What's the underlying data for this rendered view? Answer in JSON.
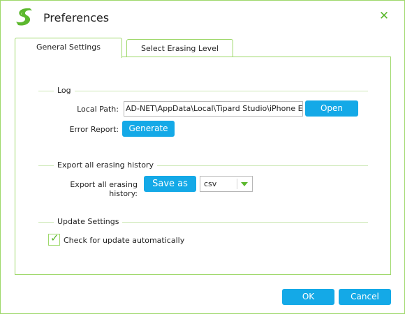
{
  "window": {
    "title": "Preferences",
    "close_glyph": "✕"
  },
  "tabs": [
    {
      "label": "General Settings",
      "active": true
    },
    {
      "label": "Select Erasing Level",
      "active": false
    }
  ],
  "log": {
    "section_title": "Log",
    "local_path_label": "Local Path:",
    "local_path_value": "AD-NET\\AppData\\Local\\Tipard Studio\\iPhone Eraser",
    "open_label": "Open",
    "error_report_label": "Error Report:",
    "generate_label": "Generate"
  },
  "export": {
    "section_title": "Export all erasing history",
    "field_label": "Export all erasing history:",
    "save_as_label": "Save as",
    "format_selected": "csv"
  },
  "update": {
    "section_title": "Update Settings",
    "auto_update_label": "Check for update automatically",
    "auto_update_checked": true
  },
  "footer": {
    "ok_label": "OK",
    "cancel_label": "Cancel"
  },
  "colors": {
    "accent_green": "#5cb82e",
    "border_green": "#9ed86a",
    "button_blue": "#14a9e7"
  }
}
